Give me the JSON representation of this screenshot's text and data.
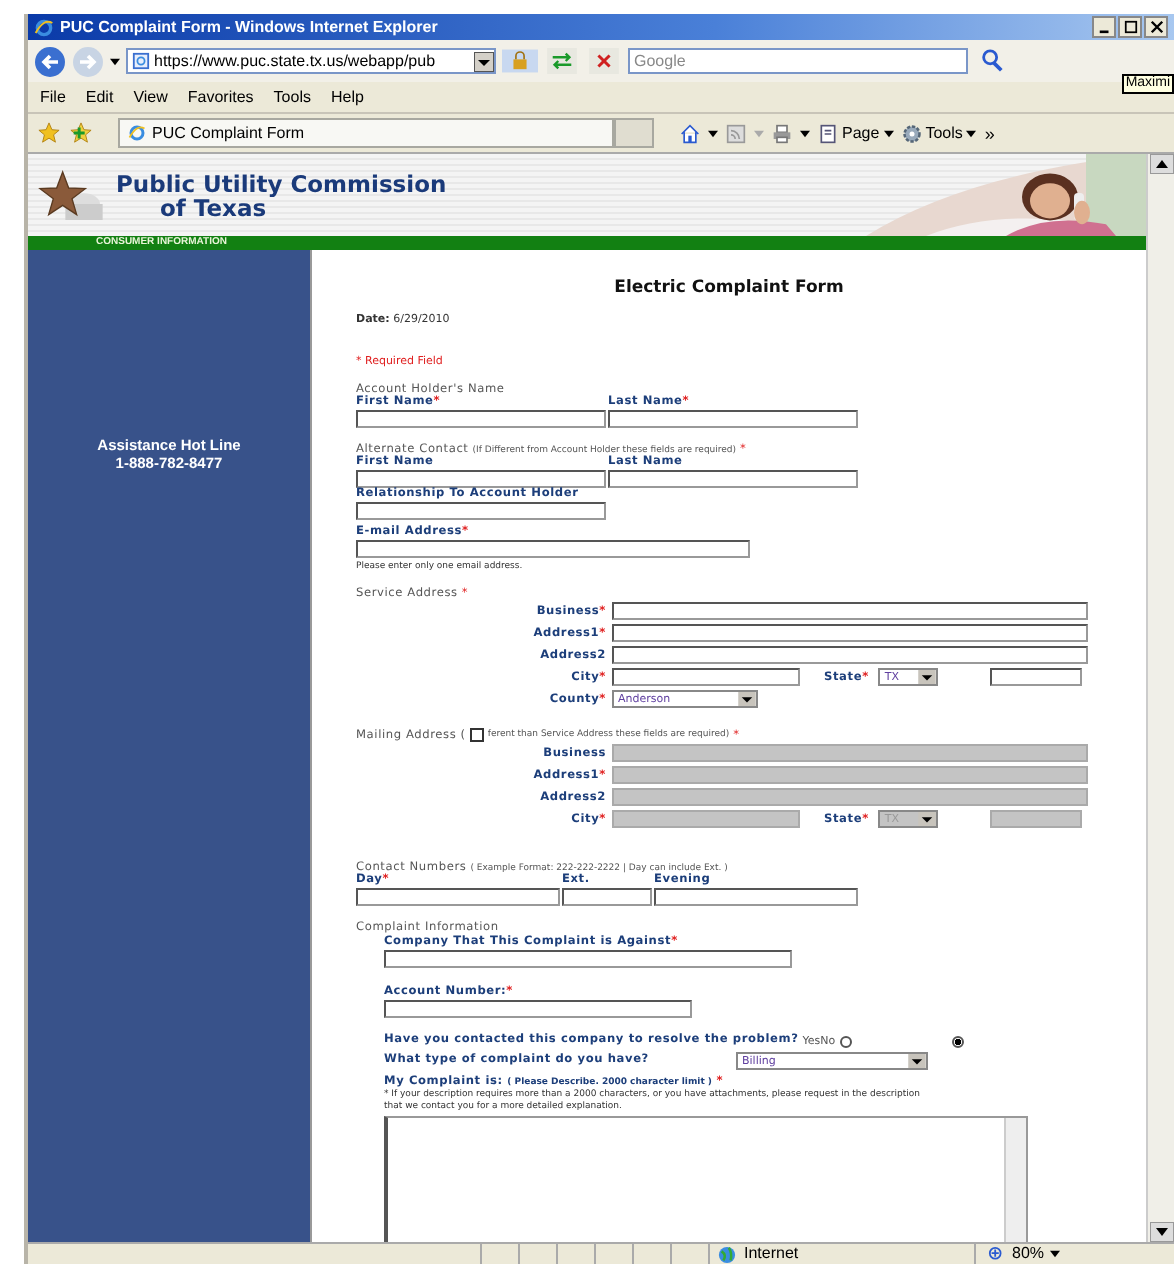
{
  "window": {
    "title": "PUC Complaint Form - Windows Internet Explorer"
  },
  "address_bar": {
    "url": "https://www.puc.state.tx.us/webapp/pub"
  },
  "search": {
    "placeholder": "Google"
  },
  "tooltip": "Maximi",
  "menu": [
    "File",
    "Edit",
    "View",
    "Favorites",
    "Tools",
    "Help"
  ],
  "tab": {
    "title": "PUC Complaint Form"
  },
  "command_bar": {
    "page": "Page",
    "tools": "Tools",
    "more": "»"
  },
  "banner": {
    "title_line_1": "Public Utility Commission",
    "title_line_2": "of Texas",
    "section": "CONSUMER INFORMATION"
  },
  "sidebar": {
    "hotline_label": "Assistance Hot Line",
    "hotline_number": "1-888-782-8477"
  },
  "form": {
    "title": "Electric Complaint Form",
    "date_label": "Date:",
    "date": "6/29/2010",
    "required_note": "* Required Field",
    "account_holder": {
      "heading": "Account Holder's Name",
      "fields": [
        {
          "label": "First Name",
          "mark": "*"
        },
        {
          "label": "Last Name",
          "mark": "*"
        }
      ]
    },
    "alternate": {
      "heading": "Alternate Contact",
      "note": "(If Different from Account Holder these fields are required)",
      "mark": "*",
      "fields": [
        {
          "label": "First Name"
        },
        {
          "label": "Last Name"
        }
      ],
      "relationship": {
        "label": "Relationship To Account Holder"
      },
      "email": {
        "label": "E-mail Address",
        "mark": "*"
      },
      "email_note": "Please enter only one email address."
    },
    "service_address": {
      "heading": "Service Address",
      "mark": "*",
      "disabled": false,
      "rows": [
        {
          "kind": "wide",
          "label": "Business",
          "mark": "*"
        },
        {
          "kind": "wide",
          "label": "Address1",
          "mark": "*"
        },
        {
          "kind": "wide",
          "label": "Address2"
        },
        {
          "kind": "city",
          "label": "City",
          "mark": "*",
          "state_label": "State",
          "state_mark": "*",
          "state": "TX"
        },
        {
          "kind": "county",
          "label": "County",
          "mark": "*",
          "value": "Anderson"
        }
      ]
    },
    "mailing_address": {
      "heading": "Mailing Address (",
      "checked": false,
      "note": "ferent than Service Address these fields are required)",
      "mark": "*",
      "disabled": true,
      "rows": [
        {
          "kind": "wide",
          "label": "Business"
        },
        {
          "kind": "wide",
          "label": "Address1",
          "mark": "*"
        },
        {
          "kind": "wide",
          "label": "Address2"
        },
        {
          "kind": "city",
          "label": "City",
          "mark": "*",
          "state_label": "State",
          "state_mark": "*",
          "state": "TX"
        }
      ]
    },
    "contact": {
      "heading": "Contact Numbers",
      "note": "( Example Format: 222-222-2222 | Day can include Ext. )",
      "fields": [
        {
          "label": "Day",
          "mark": "*"
        },
        {
          "label": "Ext."
        },
        {
          "label": "Evening"
        }
      ]
    },
    "complaint": {
      "heading": "Complaint Information",
      "company": {
        "label": "Company That This Complaint is Against",
        "mark": "*"
      },
      "account": {
        "label": "Account Number:",
        "mark": "*"
      },
      "contacted": {
        "question": "Have you contacted this company to resolve the problem?",
        "options": [
          {
            "label": "Yes",
            "selected": false
          },
          {
            "label": "No",
            "selected": true
          }
        ]
      },
      "type": {
        "question": "What type of complaint do you have?",
        "value": "Billing"
      },
      "description": {
        "label": "My Complaint is:",
        "note": "( Please Describe. 2000 character limit )",
        "mark": "*",
        "help": "* If your description requires more than a 2000 characters, or you have attachments, please request in the description that we contact you for a more detailed explanation."
      }
    }
  },
  "status_bar": {
    "zone": "Internet",
    "zoom": "80%"
  }
}
